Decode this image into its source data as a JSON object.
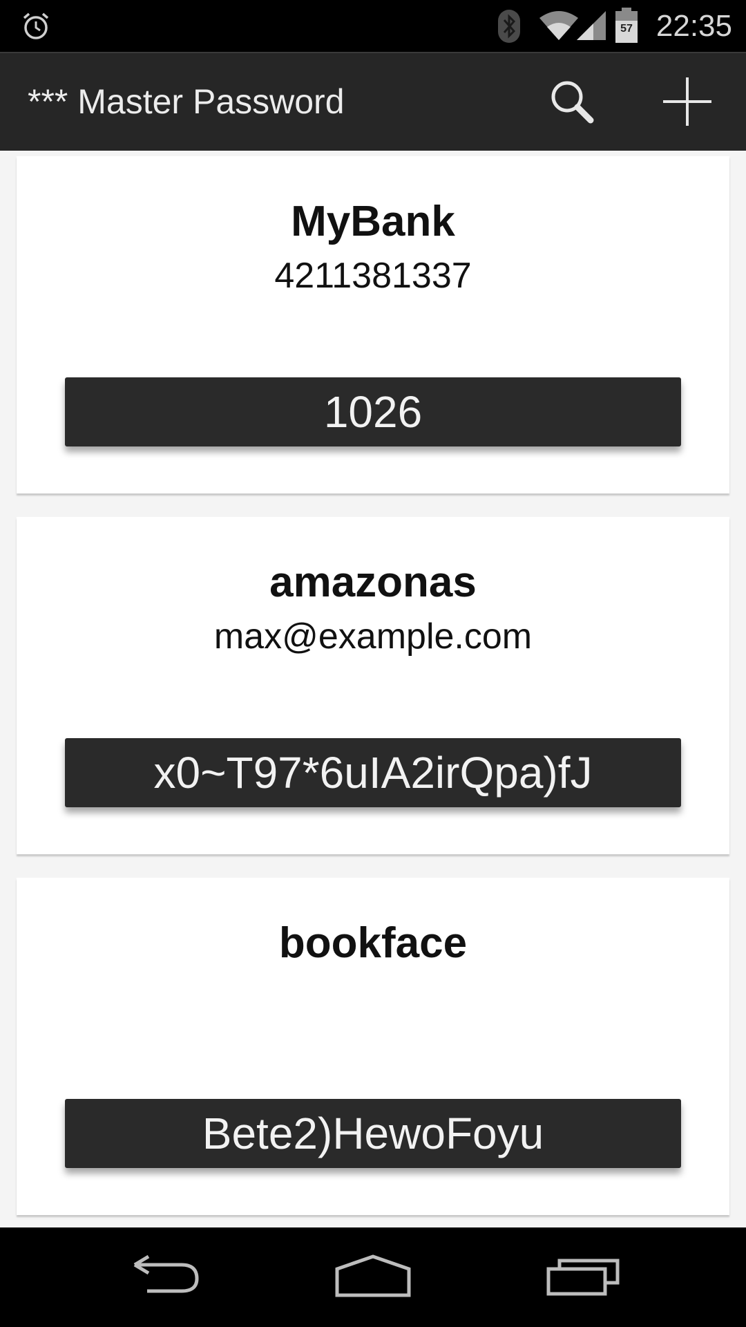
{
  "status_bar": {
    "time": "22:35",
    "battery_level": "57",
    "icons": [
      "alarm-icon",
      "bluetooth-icon",
      "wifi-icon",
      "cell-signal-icon",
      "battery-icon"
    ]
  },
  "action_bar": {
    "title": "*** Master Password",
    "icons": [
      "search-icon",
      "add-icon"
    ]
  },
  "sites": [
    {
      "name": "MyBank",
      "login": "4211381337",
      "password": "1026"
    },
    {
      "name": "amazonas",
      "login": "max@example.com",
      "password": "x0~T97*6uIA2irQpa)fJ"
    },
    {
      "name": "bookface",
      "login": "",
      "password": "Bete2)HewoFoyu"
    }
  ],
  "nav_bar": {
    "icons": [
      "back-icon",
      "home-icon",
      "recent-apps-icon"
    ]
  },
  "colors": {
    "status_bar": "#000000",
    "action_bar": "#262626",
    "background": "#f4f4f4",
    "card": "#ffffff",
    "password_button": "#2a2a2a"
  }
}
